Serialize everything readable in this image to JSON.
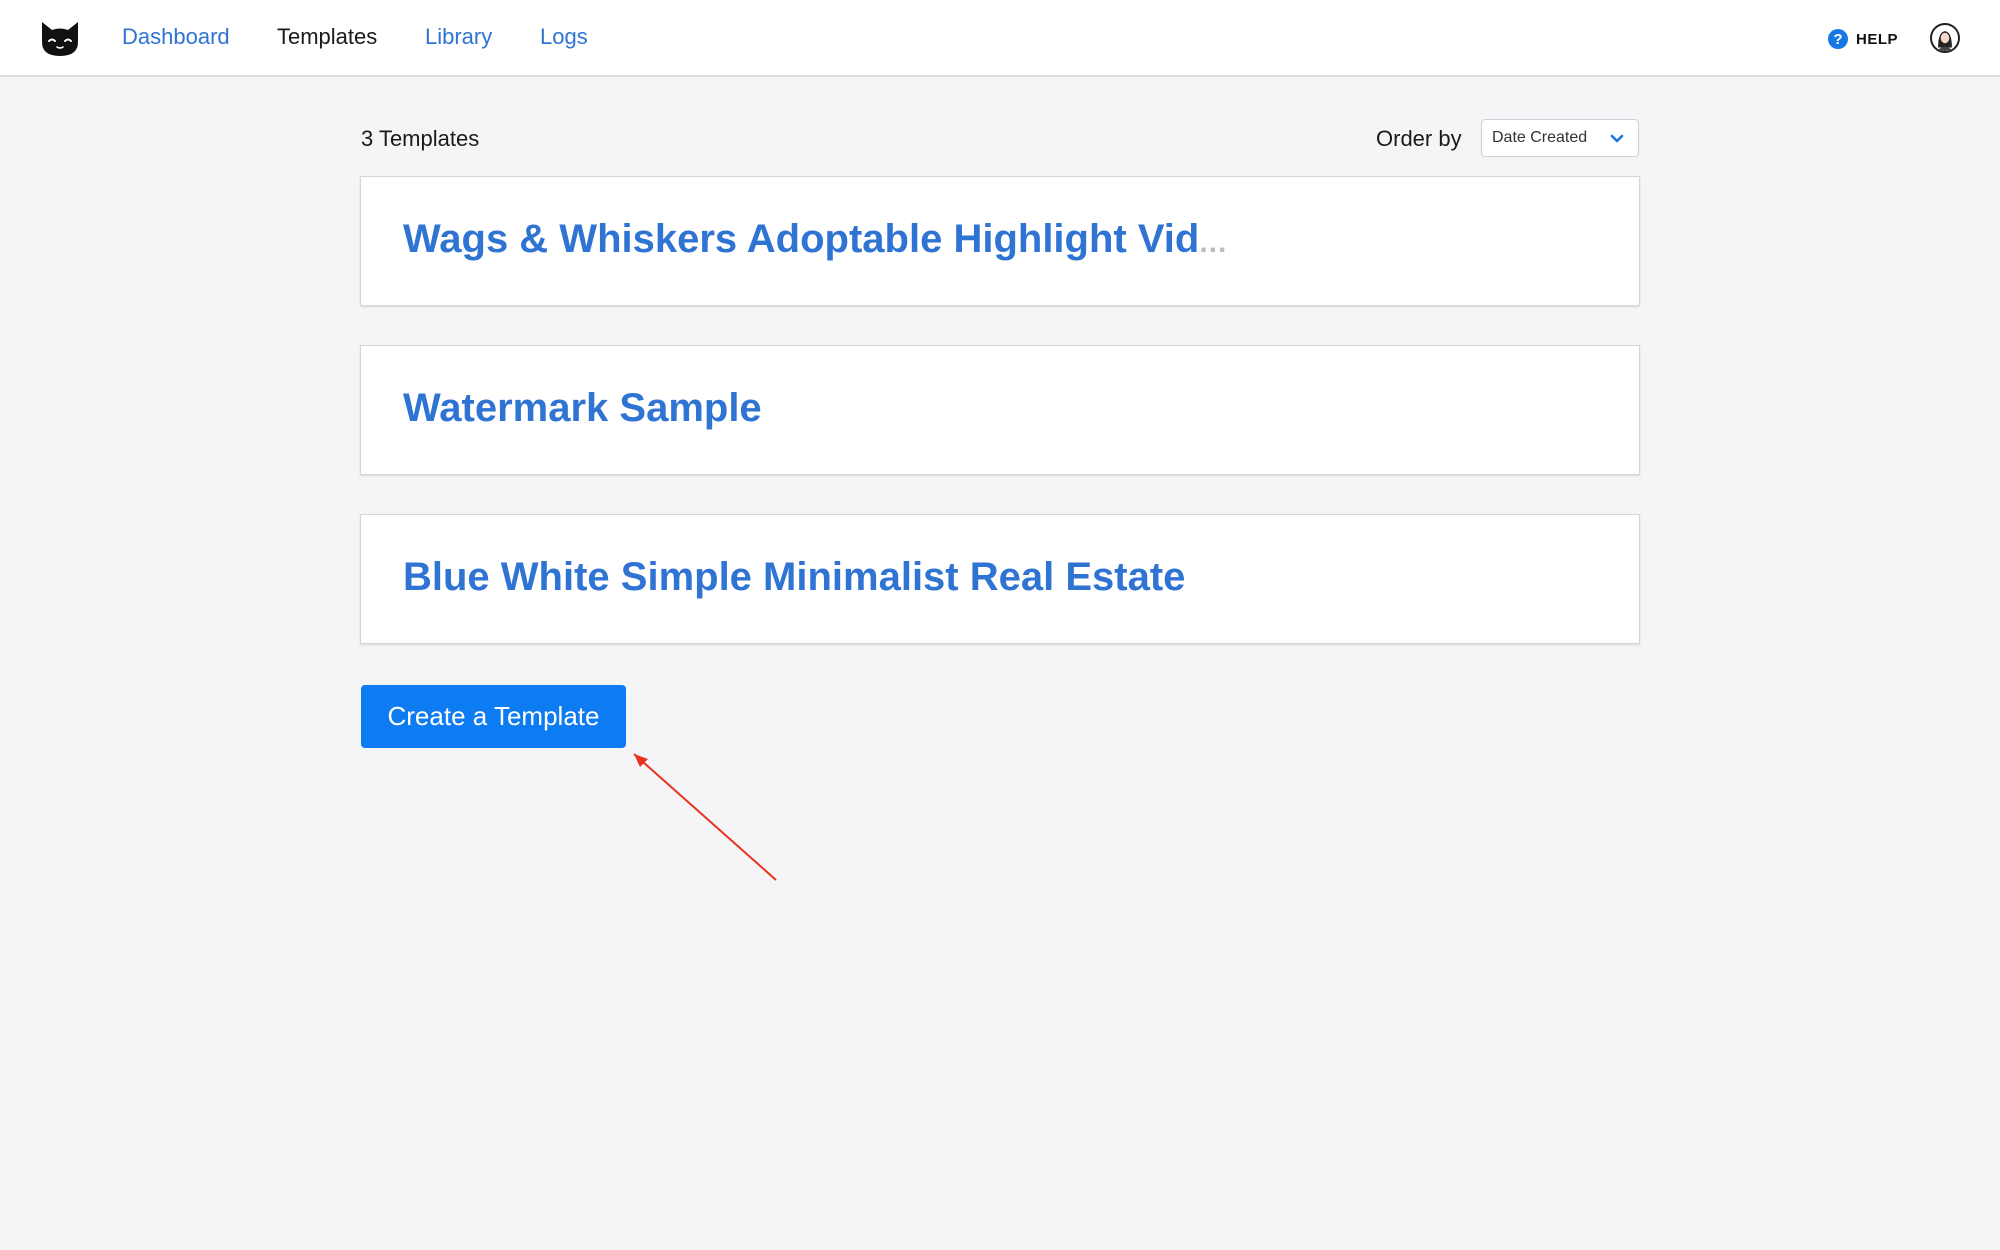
{
  "nav": {
    "items": [
      {
        "label": "Dashboard",
        "active": false
      },
      {
        "label": "Templates",
        "active": true
      },
      {
        "label": "Library",
        "active": false
      },
      {
        "label": "Logs",
        "active": false
      }
    ],
    "help_label": "HELP",
    "logo_icon": "cat-face-icon",
    "avatar_icon": "user-avatar-icon"
  },
  "list": {
    "count_label": "3 Templates",
    "order_by_label": "Order by",
    "order_by_value": "Date Created",
    "templates": [
      {
        "title": "Wags & Whiskers Adoptable Highlight Vid",
        "truncated": true
      },
      {
        "title": "Watermark Sample",
        "truncated": false
      },
      {
        "title": "Blue White Simple Minimalist Real Estate",
        "truncated": false
      }
    ],
    "ellipsis": "..."
  },
  "actions": {
    "create_label": "Create a Template"
  },
  "colors": {
    "link": "#2f73d3",
    "primary": "#0d7bf2",
    "annotation_arrow": "#e8321c",
    "background": "#f5f5f7"
  }
}
